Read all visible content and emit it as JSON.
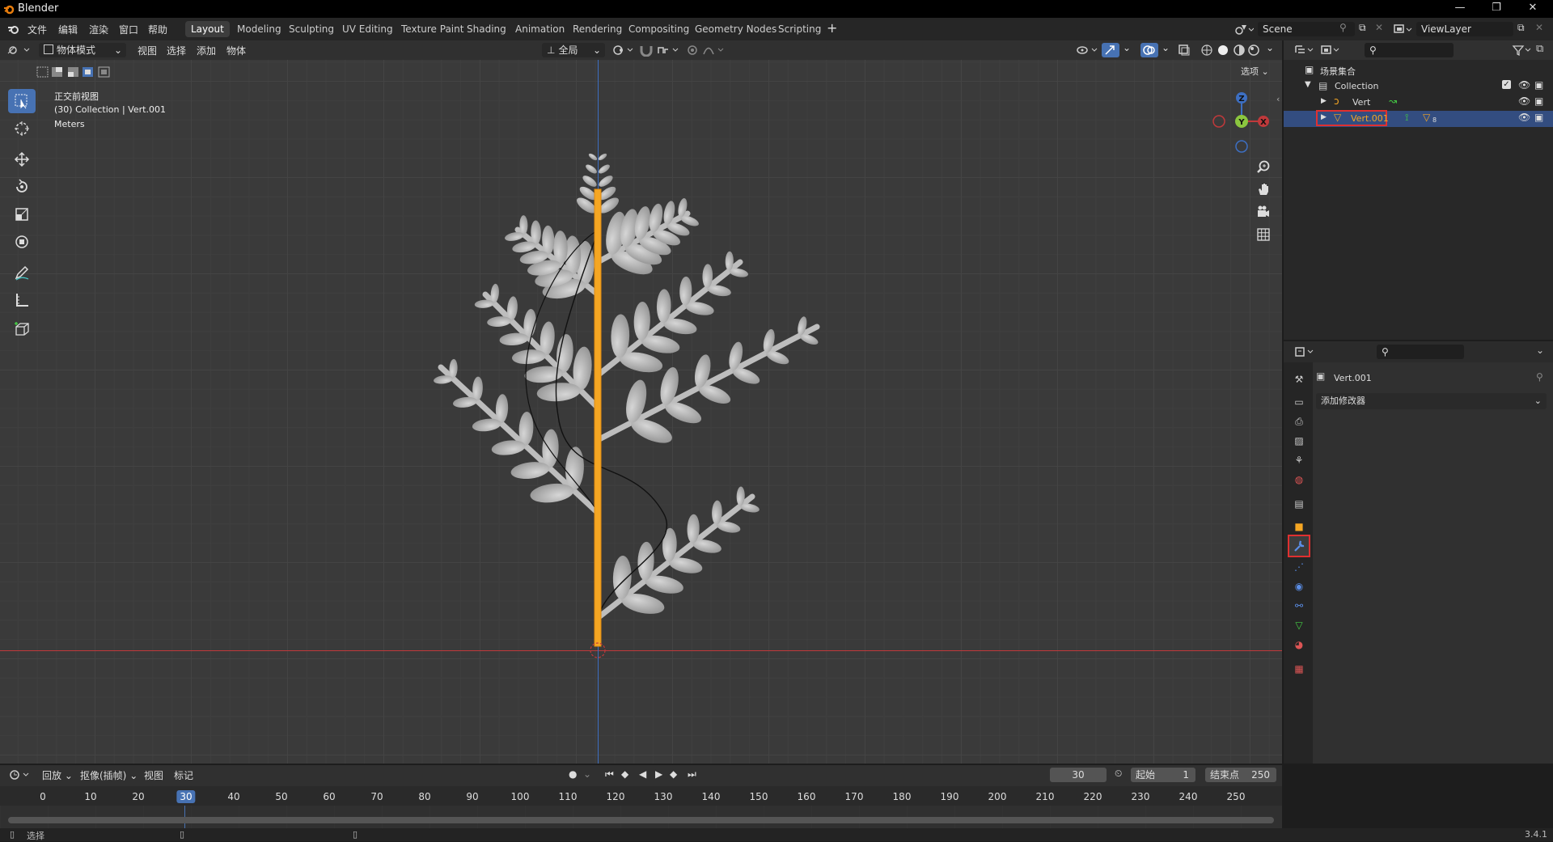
{
  "app": {
    "title": "Blender",
    "version": "3.4.1"
  },
  "menus": [
    "文件",
    "编辑",
    "渲染",
    "窗口",
    "帮助"
  ],
  "workspaces": [
    "Layout",
    "Modeling",
    "Sculpting",
    "UV Editing",
    "Texture Paint",
    "Shading",
    "Animation",
    "Rendering",
    "Compositing",
    "Geometry Nodes",
    "Scripting"
  ],
  "active_workspace": "Layout",
  "scene": {
    "name": "Scene",
    "view_layer": "ViewLayer"
  },
  "viewport_header": {
    "mode": "物体模式",
    "menus": [
      "视图",
      "选择",
      "添加",
      "物体"
    ],
    "transform_orientation": "全局",
    "options_label": "选项"
  },
  "viewport": {
    "view_name": "正交前视图",
    "collection_info": "(30) Collection | Vert.001",
    "units": "Meters"
  },
  "gizmo": {
    "z": "Z",
    "y": "Y",
    "x": "X"
  },
  "outliner": {
    "root": "场景集合",
    "collection": "Collection",
    "objects": [
      {
        "name": "Vert",
        "selected": false
      },
      {
        "name": "Vert.001",
        "selected": true,
        "count": "8"
      }
    ]
  },
  "properties": {
    "object_name": "Vert.001",
    "add_modifier": "添加修改器",
    "active_tab": "modifier"
  },
  "timeline": {
    "menus": [
      "回放",
      "抠像(插帧)",
      "视图",
      "标记"
    ],
    "current_frame": "30",
    "start_label": "起始",
    "start": "1",
    "end_label": "结束点",
    "end": "250",
    "ticks": [
      "0",
      "10",
      "20",
      "30",
      "40",
      "50",
      "60",
      "70",
      "80",
      "90",
      "100",
      "110",
      "120",
      "130",
      "140",
      "150",
      "160",
      "170",
      "180",
      "190",
      "200",
      "210",
      "220",
      "230",
      "240",
      "250"
    ]
  },
  "statusbar": {
    "select": "选择"
  },
  "colors": {
    "accent": "#4772b3",
    "highlight": "#e03030",
    "selection": "#f5a623"
  }
}
